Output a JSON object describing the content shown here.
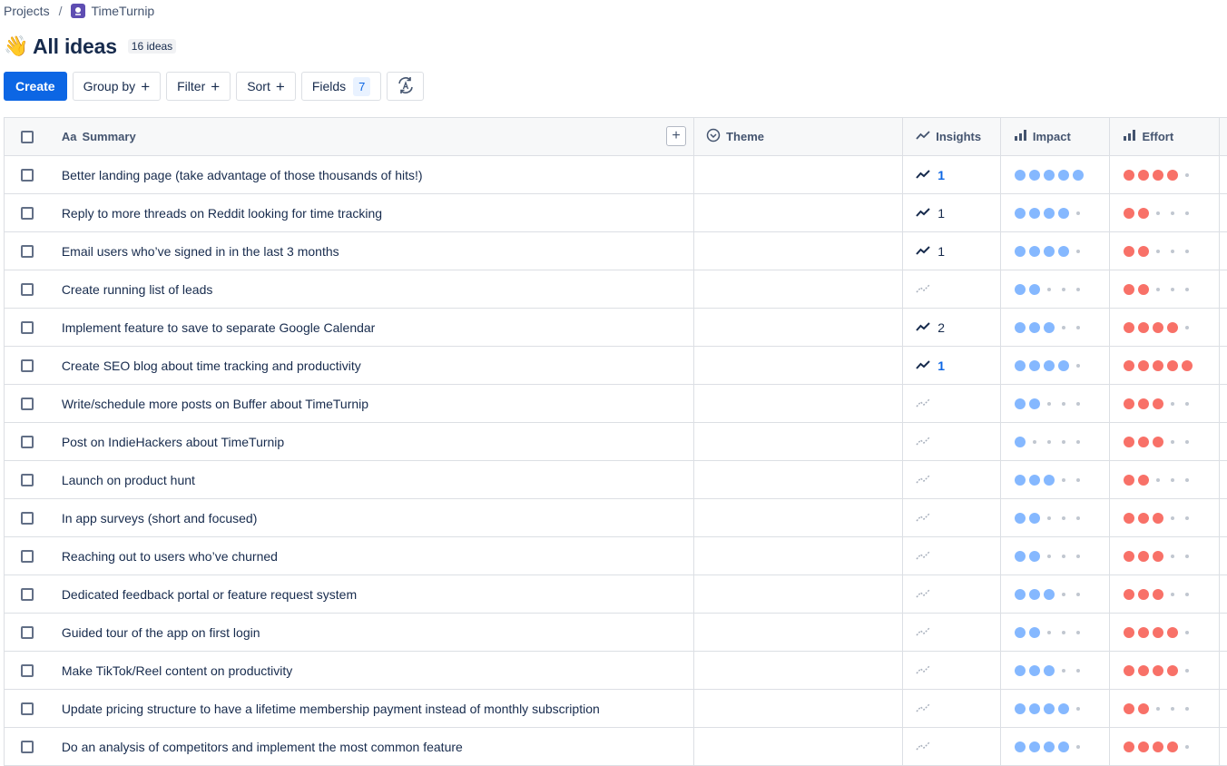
{
  "breadcrumb": {
    "projects": "Projects",
    "separator": "/",
    "project": "TimeTurnip"
  },
  "page": {
    "emoji": "👋",
    "title": "All ideas",
    "count": "16 ideas"
  },
  "toolbar": {
    "create": "Create",
    "group_by": "Group by",
    "filter": "Filter",
    "sort": "Sort",
    "fields": "Fields",
    "fields_count": "7",
    "plus": "+"
  },
  "columns": {
    "summary_prefix": "Aa",
    "summary": "Summary",
    "theme": "Theme",
    "insights": "Insights",
    "impact": "Impact",
    "effort": "Effort"
  },
  "colors": {
    "accent": "#0c66e4",
    "impact": "#85b8ff",
    "effort": "#f87168"
  },
  "rows": [
    {
      "summary": "Better landing page (take advantage of those thousands of hits!)",
      "theme": "",
      "insights": "1",
      "insights_link": true,
      "impact": 5,
      "effort": 4
    },
    {
      "summary": "Reply to more threads on Reddit looking for time tracking",
      "theme": "",
      "insights": "1",
      "insights_link": false,
      "impact": 4,
      "effort": 2
    },
    {
      "summary": "Email users who’ve signed in in the last 3 months",
      "theme": "",
      "insights": "1",
      "insights_link": false,
      "impact": 4,
      "effort": 2
    },
    {
      "summary": "Create running list of leads",
      "theme": "",
      "insights": "",
      "insights_link": false,
      "impact": 2,
      "effort": 2
    },
    {
      "summary": "Implement feature to save to separate Google Calendar",
      "theme": "",
      "insights": "2",
      "insights_link": false,
      "impact": 3,
      "effort": 4
    },
    {
      "summary": "Create SEO blog about time tracking and productivity",
      "theme": "",
      "insights": "1",
      "insights_link": true,
      "impact": 4,
      "effort": 5
    },
    {
      "summary": "Write/schedule more posts on Buffer about TimeTurnip",
      "theme": "",
      "insights": "",
      "insights_link": false,
      "impact": 2,
      "effort": 3
    },
    {
      "summary": "Post on IndieHackers about TimeTurnip",
      "theme": "",
      "insights": "",
      "insights_link": false,
      "impact": 1,
      "effort": 3
    },
    {
      "summary": "Launch on product hunt",
      "theme": "",
      "insights": "",
      "insights_link": false,
      "impact": 3,
      "effort": 2
    },
    {
      "summary": "In app surveys (short and focused)",
      "theme": "",
      "insights": "",
      "insights_link": false,
      "impact": 2,
      "effort": 3
    },
    {
      "summary": "Reaching out to users who’ve churned",
      "theme": "",
      "insights": "",
      "insights_link": false,
      "impact": 2,
      "effort": 3
    },
    {
      "summary": "Dedicated feedback portal or feature request system",
      "theme": "",
      "insights": "",
      "insights_link": false,
      "impact": 3,
      "effort": 3
    },
    {
      "summary": "Guided tour of the app on first login",
      "theme": "",
      "insights": "",
      "insights_link": false,
      "impact": 2,
      "effort": 4
    },
    {
      "summary": "Make TikTok/Reel content on productivity",
      "theme": "",
      "insights": "",
      "insights_link": false,
      "impact": 3,
      "effort": 4
    },
    {
      "summary": "Update pricing structure to have a lifetime membership payment instead of monthly subscription",
      "theme": "",
      "insights": "",
      "insights_link": false,
      "impact": 4,
      "effort": 2
    },
    {
      "summary": "Do an analysis of competitors and implement the most common feature",
      "theme": "",
      "insights": "",
      "insights_link": false,
      "impact": 4,
      "effort": 4
    }
  ]
}
